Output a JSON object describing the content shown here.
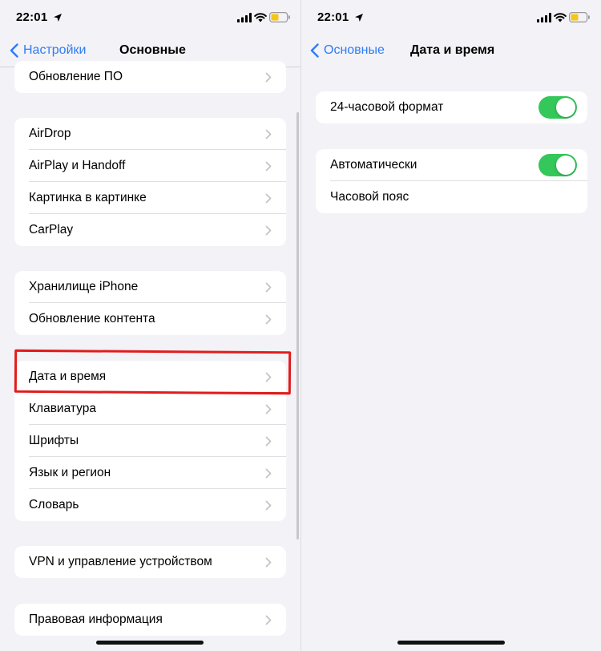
{
  "colors": {
    "accent": "#2f7cf6",
    "toggle_on": "#34c759",
    "highlight": "#e21b1b",
    "battery": "#f5c518",
    "background": "#f2f2f7"
  },
  "left": {
    "status": {
      "time": "22:01"
    },
    "nav": {
      "back_label": "Настройки",
      "title": "Основные"
    },
    "groups": [
      {
        "items": [
          {
            "label": "Обновление ПО"
          }
        ]
      },
      {
        "items": [
          {
            "label": "AirDrop"
          },
          {
            "label": "AirPlay и Handoff"
          },
          {
            "label": "Картинка в картинке"
          },
          {
            "label": "CarPlay"
          }
        ]
      },
      {
        "items": [
          {
            "label": "Хранилище iPhone"
          },
          {
            "label": "Обновление контента"
          }
        ]
      },
      {
        "items": [
          {
            "label": "Дата и время"
          },
          {
            "label": "Клавиатура"
          },
          {
            "label": "Шрифты"
          },
          {
            "label": "Язык и регион"
          },
          {
            "label": "Словарь"
          }
        ]
      },
      {
        "items": [
          {
            "label": "VPN и управление устройством"
          }
        ]
      },
      {
        "items": [
          {
            "label": "Правовая информация"
          }
        ]
      }
    ],
    "highlighted_item": "Дата и время"
  },
  "right": {
    "status": {
      "time": "22:01"
    },
    "nav": {
      "back_label": "Основные",
      "title": "Дата и время"
    },
    "groups": [
      {
        "items": [
          {
            "label": "24-часовой формат",
            "toggle": true
          }
        ]
      },
      {
        "items": [
          {
            "label": "Автоматически",
            "toggle": true
          },
          {
            "label": "Часовой пояс"
          }
        ]
      }
    ]
  },
  "icons": [
    "location-arrow-icon",
    "cellular-signal-icon",
    "wifi-icon",
    "battery-icon",
    "chevron-left-icon",
    "chevron-right-icon"
  ]
}
